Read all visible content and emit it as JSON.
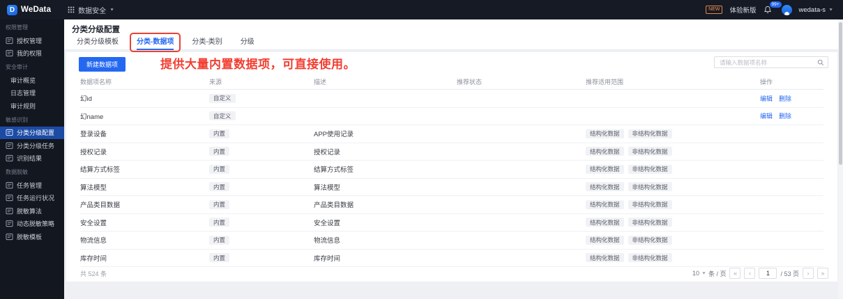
{
  "topbar": {
    "logo_letter": "D",
    "logo_text": "WeData",
    "product_switcher": "数据安全",
    "new_badge": "NEW",
    "try_new_label": "体验新版",
    "notification_count": "99+",
    "user_name": "wedata-s"
  },
  "sidebar": {
    "sections": [
      {
        "label": "权限管理",
        "items": [
          {
            "label": "授权管理",
            "icon": "auth-manage-icon"
          },
          {
            "label": "我的权限",
            "icon": "my-permissions-icon"
          }
        ]
      },
      {
        "label": "安全审计",
        "items": [
          {
            "label": "审计概览"
          },
          {
            "label": "日志管理"
          },
          {
            "label": "审计规则"
          }
        ]
      },
      {
        "label": "敏感识别",
        "items": [
          {
            "label": "分类分级配置",
            "icon": "classify-config-icon",
            "active": true
          },
          {
            "label": "分类分级任务",
            "icon": "classify-task-icon"
          },
          {
            "label": "识别结果",
            "icon": "recognition-result-icon"
          }
        ]
      },
      {
        "label": "数据脱敏",
        "items": [
          {
            "label": "任务管理",
            "icon": "task-manage-icon"
          },
          {
            "label": "任务运行状况",
            "icon": "task-status-icon"
          },
          {
            "label": "脱敏算法",
            "icon": "masking-algorithm-icon"
          },
          {
            "label": "动态脱敏策略",
            "icon": "dynamic-masking-icon"
          },
          {
            "label": "脱敏模板",
            "icon": "masking-template-icon"
          }
        ]
      }
    ]
  },
  "page": {
    "title": "分类分级配置",
    "tabs": [
      {
        "label": "分类分级模板"
      },
      {
        "label": "分类-数据项",
        "active": true,
        "highlighted": true
      },
      {
        "label": "分类-类别"
      },
      {
        "label": "分级"
      }
    ],
    "annotation": "提供大量内置数据项，可直接使用。"
  },
  "toolbar": {
    "new_button": "新建数据项",
    "search_placeholder": "请输入数据项名称"
  },
  "table": {
    "columns": [
      "数据项名称",
      "来源",
      "描述",
      "推荐状态",
      "推荐适用范围",
      "操作"
    ],
    "rows": [
      {
        "name": "幻id",
        "source": "自定义",
        "desc": "",
        "toggle": true,
        "scopes": [],
        "actions": [
          "编辑",
          "删除"
        ]
      },
      {
        "name": "幻name",
        "source": "自定义",
        "desc": "",
        "toggle": true,
        "scopes": [],
        "actions": [
          "编辑",
          "删除"
        ]
      },
      {
        "name": "登录设备",
        "source": "内置",
        "desc": "APP使用记录",
        "toggle": false,
        "scopes": [
          "结构化数据",
          "非结构化数据"
        ],
        "actions": []
      },
      {
        "name": "授权记录",
        "source": "内置",
        "desc": "授权记录",
        "toggle": false,
        "scopes": [
          "结构化数据",
          "非结构化数据"
        ],
        "actions": []
      },
      {
        "name": "结算方式标签",
        "source": "内置",
        "desc": "结算方式标签",
        "toggle": false,
        "scopes": [
          "结构化数据",
          "非结构化数据"
        ],
        "actions": []
      },
      {
        "name": "算法模型",
        "source": "内置",
        "desc": "算法模型",
        "toggle": false,
        "scopes": [
          "结构化数据",
          "非结构化数据"
        ],
        "actions": []
      },
      {
        "name": "产品类目数据",
        "source": "内置",
        "desc": "产品类目数据",
        "toggle": false,
        "scopes": [
          "结构化数据",
          "非结构化数据"
        ],
        "actions": []
      },
      {
        "name": "安全设置",
        "source": "内置",
        "desc": "安全设置",
        "toggle": false,
        "scopes": [
          "结构化数据",
          "非结构化数据"
        ],
        "actions": []
      },
      {
        "name": "物流信息",
        "source": "内置",
        "desc": "物流信息",
        "toggle": false,
        "scopes": [
          "结构化数据",
          "非结构化数据"
        ],
        "actions": []
      },
      {
        "name": "库存时间",
        "source": "内置",
        "desc": "库存时间",
        "toggle": false,
        "scopes": [
          "结构化数据",
          "非结构化数据"
        ],
        "actions": []
      }
    ]
  },
  "pagination": {
    "total_label": "共 524 条",
    "page_size": "10",
    "unit_label": "条 / 页",
    "current_page": "1",
    "page_count_label": "/ 53 页",
    "first_glyph": "«",
    "prev_glyph": "‹",
    "next_glyph": "›",
    "last_glyph": "»"
  },
  "colors": {
    "accent_blue": "#2468f2",
    "annotation_red": "#f23e31",
    "sidebar_active": "#1c4ba5",
    "topbar_bg": "#151a24",
    "toggle_on": "#8cb8f7"
  }
}
